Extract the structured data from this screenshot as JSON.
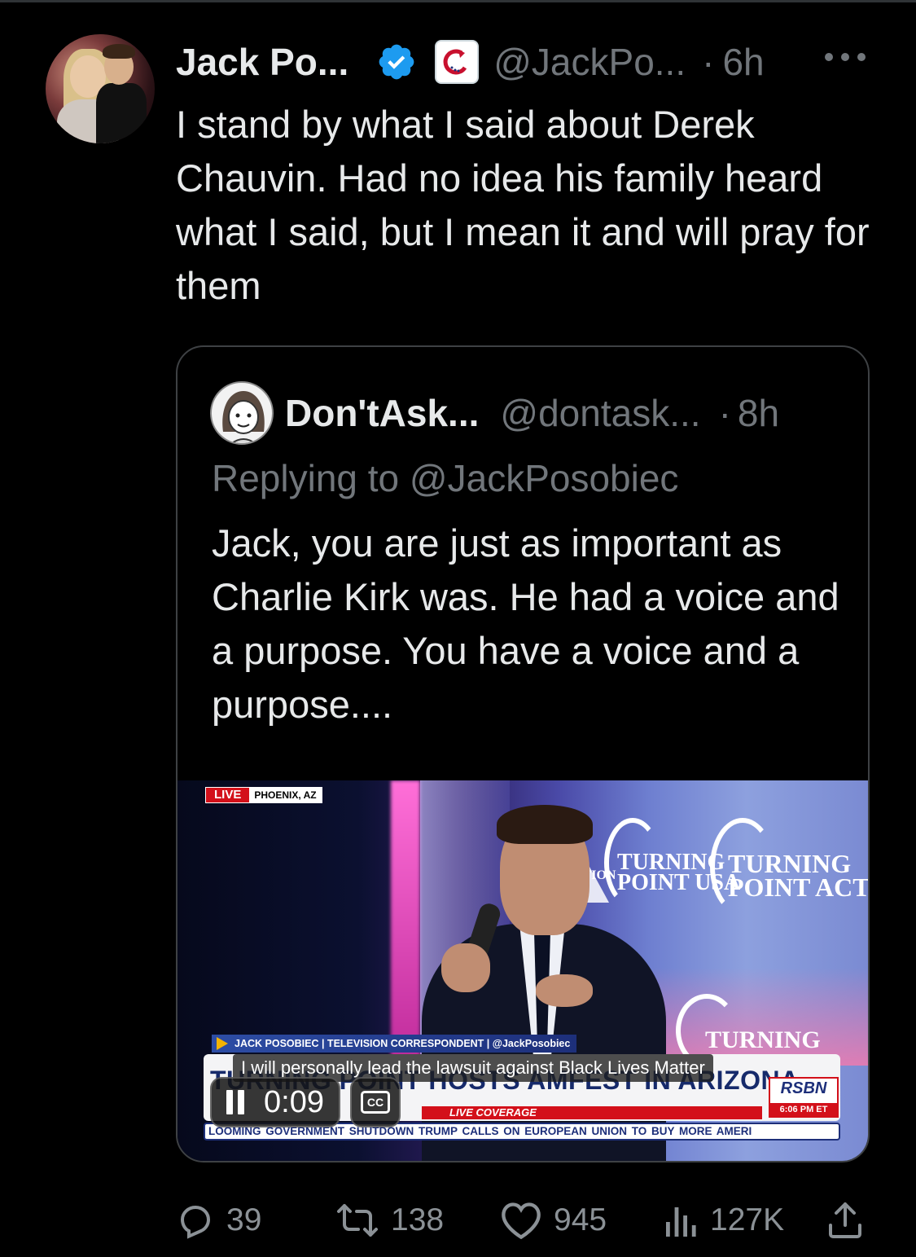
{
  "tweet": {
    "author_name": "Jack Po...",
    "handle": "@JackPo...",
    "separator": "·",
    "time": "6h",
    "text": "I stand by what I said about Derek Chauvin. Had no idea his family heard what I said, but I mean it and will pray for them",
    "verified_badge": "verified-badge-icon",
    "affiliate_badge": "affiliate-badge-icon",
    "more_icon": "more-icon"
  },
  "quote": {
    "author_name": "Don'tAsk...",
    "handle": "@dontask...",
    "separator": "·",
    "time": "8h",
    "replying_to": "Replying to @JackPosobiec",
    "text": "Jack, you are just as important as Charlie Kirk was. He had a voice and a purpose. You have a voice and a purpose....",
    "video": {
      "live_label": "LIVE",
      "location": "PHOENIX, AZ",
      "logo_1": "TURNING\nPOINT USA",
      "logo_2": "TURNING\nPOINT ACTION",
      "logo_3": "TURNING",
      "logo_0": "CTION",
      "lower_third": "JACK POSOBIEC | TELEVISION CORRESPONDENT | @JackPosobiec",
      "headline": "TURNING POINT HOSTS AMFEST IN ARIZONA",
      "caption": "I will personally lead the lawsuit against Black Lives Matter",
      "live_coverage": "LIVE COVERAGE",
      "network": "RSBN",
      "network_time": "6:06 PM ET",
      "ticker": "LOOMING GOVERNMENT SHUTDOWN    TRUMP CALLS ON EUROPEAN UNION TO BUY MORE AMERI",
      "elapsed": "0:09",
      "cc_label": "CC"
    }
  },
  "actions": {
    "replies": "39",
    "reposts": "138",
    "likes": "945",
    "views": "127K"
  },
  "colors": {
    "background": "#000000",
    "text": "#e7e9ea",
    "secondary": "#71767b",
    "verified": "#1d9bf0",
    "border": "#3e4144"
  }
}
